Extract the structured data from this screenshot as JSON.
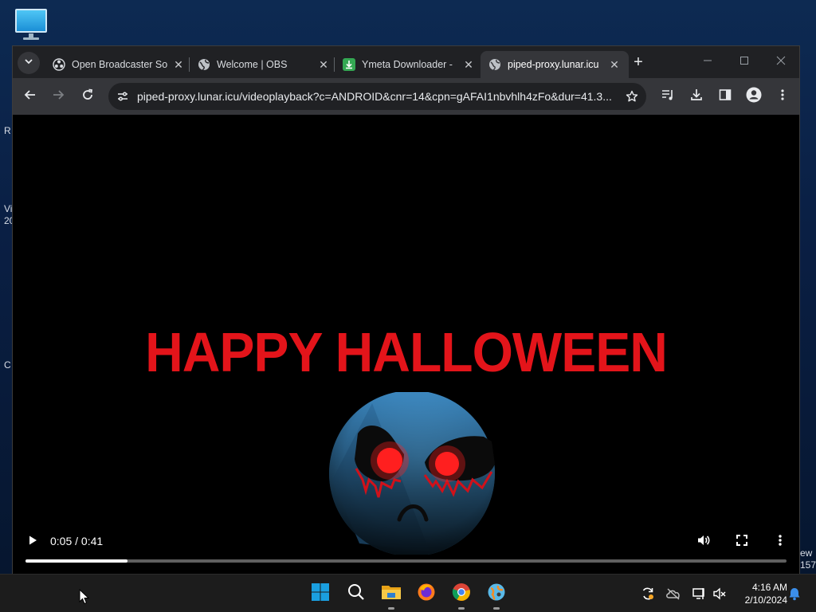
{
  "desktop": {
    "left_fragments": [
      "R",
      "Vi",
      "20",
      "C"
    ],
    "right_fragments": [
      "ew",
      "157"
    ]
  },
  "browser": {
    "tabs": [
      {
        "title": "Open Broadcaster So",
        "icon": "obs-icon",
        "active": false
      },
      {
        "title": "Welcome | OBS",
        "icon": "globe-icon",
        "active": false
      },
      {
        "title": "Ymeta Downloader -",
        "icon": "download-icon",
        "active": false
      },
      {
        "title": "piped-proxy.lunar.icu",
        "icon": "globe-icon",
        "active": true
      }
    ],
    "close_glyph": "✕",
    "new_tab_glyph": "+",
    "url": "piped-proxy.lunar.icu/videoplayback?c=ANDROID&cnr=14&cpn=gAFAI1nbvhlh4zFo&dur=41.3..."
  },
  "video": {
    "title_text": "HAPPY HALLOWEEN",
    "time_display": "0:05 / 0:41",
    "progress_fraction": 0.134
  },
  "taskbar": {
    "time": "4:16 AM",
    "date": "2/10/2024"
  },
  "colors": {
    "accent_red": "#e3141a",
    "face_blue": "#3f8fc7",
    "windows_blue": "#1a9fe0"
  }
}
